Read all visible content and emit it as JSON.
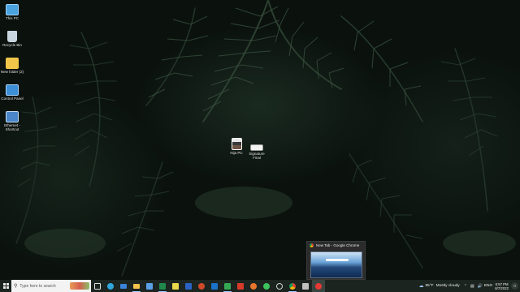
{
  "desktop": {
    "icons": [
      {
        "label": "This PC",
        "icon": "computer-icon",
        "color": "#4aa3df"
      },
      {
        "label": "Recycle Bin",
        "icon": "recycle-bin-icon",
        "color": "#c8d4de"
      },
      {
        "label": "New folder (2)",
        "icon": "folder-icon",
        "color": "#f0c64a"
      },
      {
        "label": "Control Panel",
        "icon": "control-panel-icon",
        "color": "#3d8fd6"
      },
      {
        "label": "Ethernet - Shortcut",
        "icon": "ethernet-icon",
        "color": "#4a86c8"
      },
      {
        "label": "Nija Pic",
        "icon": "photo-icon",
        "color": "#dcdcdc"
      },
      {
        "label": "Signature Final",
        "icon": "signature-image-icon",
        "color": "#f2f2f2"
      }
    ]
  },
  "preview": {
    "title": "New Tab - Google Chrome",
    "icon": "chrome-icon"
  },
  "taskbar": {
    "search_placeholder": "Type here to search",
    "apps": [
      {
        "name": "task-view",
        "icon": "task-view-icon",
        "color": "#e0e0e0"
      },
      {
        "name": "edge",
        "icon": "edge-icon",
        "color": "#2fa8e0"
      },
      {
        "name": "mail",
        "icon": "mail-icon",
        "color": "#3b82d8"
      },
      {
        "name": "explorer",
        "icon": "file-explorer-icon",
        "color": "#f2c24a"
      },
      {
        "name": "photos",
        "icon": "photos-icon",
        "color": "#5aa0e6"
      },
      {
        "name": "excel",
        "icon": "excel-icon",
        "color": "#1f8a4c"
      },
      {
        "name": "app-yellow",
        "icon": "sticky-notes-icon",
        "color": "#e8d84a"
      },
      {
        "name": "word",
        "icon": "word-icon",
        "color": "#2b63c4"
      },
      {
        "name": "powerpoint",
        "icon": "powerpoint-icon",
        "color": "#d04a2a"
      },
      {
        "name": "outlook",
        "icon": "outlook-icon",
        "color": "#1a73c8"
      },
      {
        "name": "camtasia",
        "icon": "camtasia-icon",
        "color": "#34a853"
      },
      {
        "name": "app-red",
        "icon": "app-red-icon",
        "color": "#d83b2a"
      },
      {
        "name": "firefox",
        "icon": "firefox-icon",
        "color": "#e8772e"
      },
      {
        "name": "whatsapp",
        "icon": "whatsapp-icon",
        "color": "#3cc35c"
      },
      {
        "name": "settings",
        "icon": "settings-icon",
        "color": "#d0d0d0"
      },
      {
        "name": "chrome",
        "icon": "chrome-icon",
        "color": "#e8453c"
      },
      {
        "name": "app-gray",
        "icon": "app-icon",
        "color": "#bfbfbf"
      },
      {
        "name": "recorder",
        "icon": "screen-recorder-icon",
        "color": "#e53935"
      }
    ],
    "weather_temp": "85°F",
    "weather_text": "Mostly cloudy",
    "language": "ENG",
    "time": "6:57 PM",
    "date": "8/7/2022"
  }
}
